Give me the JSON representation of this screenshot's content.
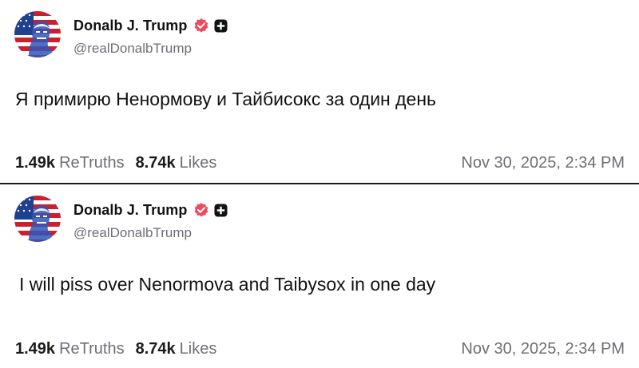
{
  "posts": [
    {
      "author": {
        "name": "Donalb J. Trump",
        "handle": "@realDonalbTrump",
        "verified_icon": "verified-badge-icon",
        "badge_icon": "plus-badge-icon",
        "avatar": "avatar-flag-portrait"
      },
      "text": "Я примирю Ненормову и Тайбисокс за один день",
      "stats": {
        "retruths_count": "1.49k",
        "retruths_label": "ReTruths",
        "likes_count": "8.74k",
        "likes_label": "Likes"
      },
      "timestamp": "Nov 30, 2025, 2:34 PM"
    },
    {
      "author": {
        "name": "Donalb J. Trump",
        "handle": "@realDonalbTrump",
        "verified_icon": "verified-badge-icon",
        "badge_icon": "plus-badge-icon",
        "avatar": "avatar-flag-portrait"
      },
      "text": "I will piss over Nenormova and Taibysox in one day",
      "stats": {
        "retruths_count": "1.49k",
        "retruths_label": "ReTruths",
        "likes_count": "8.74k",
        "likes_label": "Likes"
      },
      "timestamp": "Nov 30, 2025, 2:34 PM"
    }
  ],
  "colors": {
    "verified_badge": "#ef4a5d",
    "plus_badge": "#121212",
    "muted_text": "#6e6e78",
    "divider": "#1a1a1a"
  }
}
